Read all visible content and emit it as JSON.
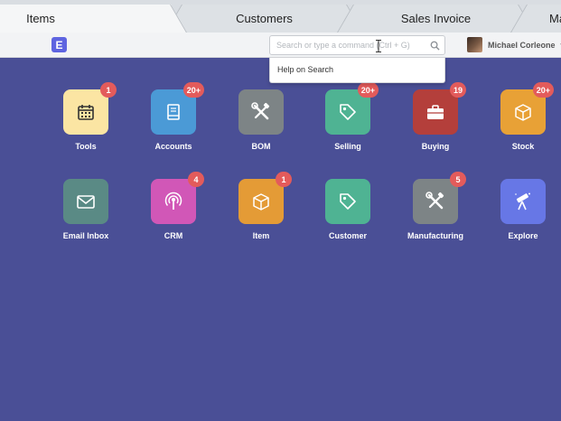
{
  "tabs": [
    {
      "label": "Items",
      "active": true
    },
    {
      "label": "Customers",
      "active": false
    },
    {
      "label": "Sales Invoice",
      "active": false
    },
    {
      "label": "Ma",
      "active": false
    }
  ],
  "navbar": {
    "logo_letter": "E",
    "search": {
      "value": "",
      "placeholder": "Search or type a command (Ctrl + G)"
    },
    "user_name": "Michael Corleone",
    "user_caret": "▾"
  },
  "search_dropdown": {
    "items": [
      {
        "label": "Help on Search"
      }
    ]
  },
  "modules": [
    {
      "label": "Tools",
      "color": "#fbe5a3",
      "icon": "calendar-icon",
      "badge": "1"
    },
    {
      "label": "Accounts",
      "color": "#4b9ad6",
      "icon": "book-icon",
      "badge": "20+"
    },
    {
      "label": "BOM",
      "color": "#7d8486",
      "icon": "tools-icon",
      "badge": null
    },
    {
      "label": "Selling",
      "color": "#4fb393",
      "icon": "tag-icon",
      "badge": "20+"
    },
    {
      "label": "Buying",
      "color": "#b43f3b",
      "icon": "briefcase-icon",
      "badge": "19"
    },
    {
      "label": "Stock",
      "color": "#e8a136",
      "icon": "box-icon",
      "badge": "20+"
    },
    {
      "label": "Email Inbox",
      "color": "#5a8a85",
      "icon": "envelope-icon",
      "badge": null
    },
    {
      "label": "CRM",
      "color": "#d157b7",
      "icon": "broadcast-icon",
      "badge": "4"
    },
    {
      "label": "Item",
      "color": "#e49b36",
      "icon": "box-icon",
      "badge": "1"
    },
    {
      "label": "Customer",
      "color": "#4fb393",
      "icon": "tag-icon",
      "badge": null
    },
    {
      "label": "Manufacturing",
      "color": "#7d8486",
      "icon": "tools-icon",
      "badge": "5"
    },
    {
      "label": "Explore",
      "color": "#6777e6",
      "icon": "telescope-icon",
      "badge": null
    }
  ]
}
